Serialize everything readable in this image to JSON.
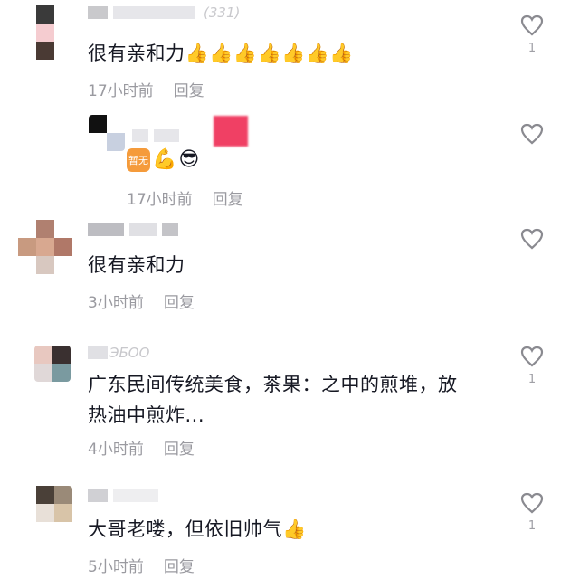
{
  "comments": [
    {
      "name_suffix": "(331)",
      "text": "很有亲和力👍👍👍👍👍👍👍",
      "time": "17小时前",
      "reply": "回复",
      "likes": "1",
      "avatar_colors": [
        "#ffffff",
        "#3a3a3a",
        "#ffffff",
        "#ffffff",
        "#f5ccd0",
        "#ffffff",
        "#ffffff",
        "#4a3a34",
        "#ffffff"
      ]
    },
    {
      "text": "",
      "time": "17小时前",
      "reply": "回复",
      "likes": "",
      "sticker": {
        "badge": "暂无",
        "emojis": [
          "💪",
          "😎"
        ]
      }
    },
    {
      "text": "很有亲和力",
      "time": "3小时前",
      "reply": "回复",
      "likes": "",
      "avatar_colors": [
        "#ffffff",
        "#b08070",
        "#ffffff",
        "#c89a80",
        "#d8a890",
        "#b07868",
        "#ffffff",
        "#d8c8c0",
        "#ffffff"
      ]
    },
    {
      "name_suffix": "ЭБОО",
      "text_line1": "广东民间传统美食，茶果：之中的煎堆，放",
      "text_line2": "热油中煎炸...",
      "time": "4小时前",
      "reply": "回复",
      "likes": "1",
      "avatar_colors": [
        "#e8c8c0",
        "#3a3030",
        "#e0d8d8",
        "#7a9aa0"
      ]
    },
    {
      "text": "大哥老喽，但依旧帅气👍",
      "time": "5小时前",
      "reply": "回复",
      "likes": "1",
      "avatar_colors": [
        "#ffffff",
        "#4a4038",
        "#9a8a78",
        "#ffffff",
        "#e8e0d8",
        "#d8c4a8",
        "#ffffff",
        "#ffffff",
        "#ffffff"
      ]
    }
  ],
  "colors": {
    "text": "#161823",
    "meta": "#9a9aa0",
    "heart": "#8a8a90"
  }
}
